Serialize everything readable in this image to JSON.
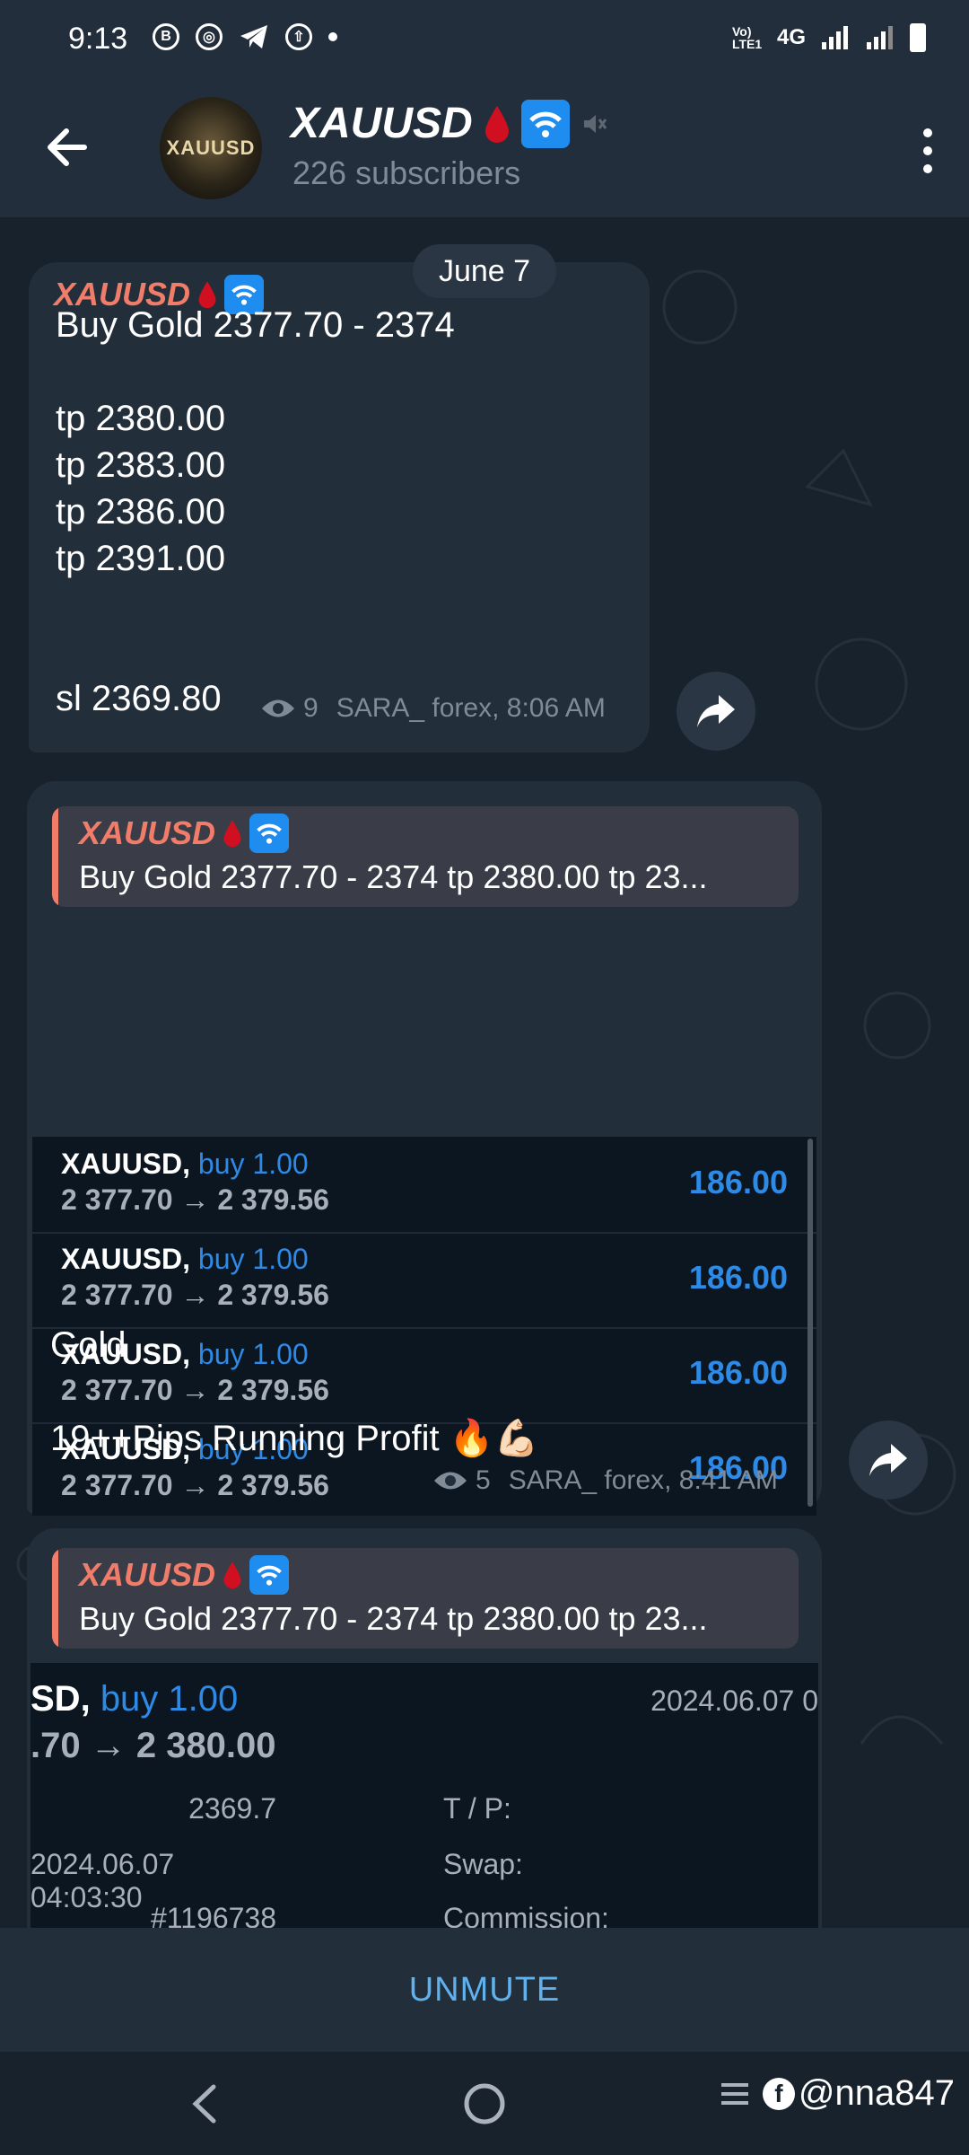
{
  "status_bar": {
    "time": "9:13",
    "network": "4G",
    "volte": "Vo) LTE1"
  },
  "header": {
    "channel_name": "XAUUSD",
    "avatar_text": "XAUUSD",
    "subscribers": "226 subscribers"
  },
  "date_divider": "June 7",
  "message1": {
    "sender": "XAUUSD",
    "text": "Buy Gold 2377.70 - 2374\n\ntp 2380.00\ntp 2383.00\ntp 2386.00\ntp 2391.00\n\n\nsl 2369.80",
    "views": "9",
    "signature": "SARA_ forex, 8:06 AM"
  },
  "message2": {
    "reply_sender": "XAUUSD",
    "reply_text": "Buy Gold 2377.70 - 2374  tp 2380.00 tp 23...",
    "trades": [
      {
        "symbol": "XAUUSD,",
        "direction": "buy 1.00",
        "prices": "2 377.70 → 2 379.56",
        "profit": "186.00"
      },
      {
        "symbol": "XAUUSD,",
        "direction": "buy 1.00",
        "prices": "2 377.70 → 2 379.56",
        "profit": "186.00"
      },
      {
        "symbol": "XAUUSD,",
        "direction": "buy 1.00",
        "prices": "2 377.70 → 2 379.56",
        "profit": "186.00"
      },
      {
        "symbol": "XAUUSD,",
        "direction": "buy 1.00",
        "prices": "2 377.70 → 2 379.56",
        "profit": "186.00"
      }
    ],
    "text": "Gold\n\n19++Pips Running Profit 🔥💪🏻",
    "views": "5",
    "signature": "SARA_ forex, 8:41 AM"
  },
  "message3": {
    "reply_sender": "XAUUSD",
    "reply_text": "Buy Gold 2377.70 - 2374  tp 2380.00 tp 23...",
    "detail": {
      "symbol": "SD,",
      "direction": "buy 1.00",
      "date_top": "2024.06.07 0",
      "prices": ".70 → 2 380.00",
      "sl_value": "2369.7",
      "tp_label": "T / P:",
      "open_time": "2024.06.07 04:03:30",
      "swap_label": "Swap:",
      "order_id": "#1196738",
      "commission_label": "Commission:"
    }
  },
  "bottom": {
    "unmute_label": "UNMUTE",
    "watermark": "@nna847"
  },
  "colors": {
    "accent_blue": "#5fb2ee",
    "sender_red": "#f07c6a",
    "profit_blue": "#2d8ae6"
  }
}
